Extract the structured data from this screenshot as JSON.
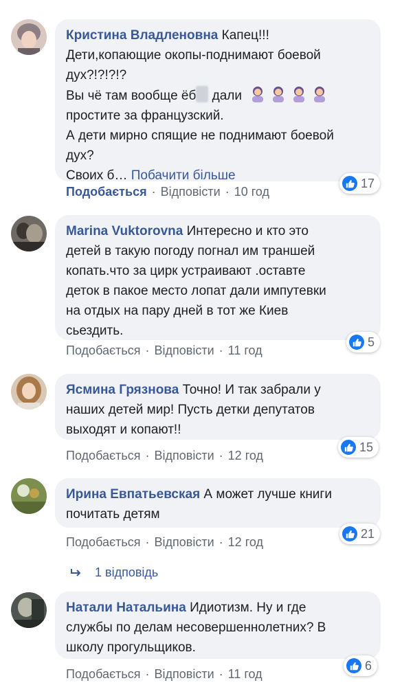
{
  "comments": [
    {
      "author": "Кристина Владленовна",
      "text_l1": " Капец!!!",
      "text_l2": "Дети,копающие окопы-поднимают боевой",
      "text_l3": "дух?!?!?!?",
      "text_l4a": "Вы чё там вообще ёб",
      "text_l4b": " дали",
      "text_l5": "простите за французский.",
      "text_l6": "А дети мирно спящие не поднимают боевой",
      "text_l7": "дух?",
      "text_l8": "Своих б… ",
      "see_more": "Побачити більше",
      "like": "Подобається",
      "reply": "Відповісти",
      "time": "10 год",
      "reactions": "17"
    },
    {
      "author": "Marina Vuktorovna",
      "text_l1": " Интересно и кто это",
      "text_l2": "детей в такую погоду погнал им траншей",
      "text_l3": "копать.что за цирк устраивают .оставте",
      "text_l4": "деток в пакое место лопат дали импутевки",
      "text_l5": "на отдых на пару дней в тот же Киев",
      "text_l6": "сьездить.",
      "like": "Подобається",
      "reply": "Відповісти",
      "time": "11 год",
      "reactions": "5"
    },
    {
      "author": "Ясмина Грязнова",
      "text_l1": " Точно! И так забрали у",
      "text_l2": "наших детей мир! Пусть детки депутатов",
      "text_l3": "выходят и копают!!",
      "like": "Подобається",
      "reply": "Відповісти",
      "time": "12 год",
      "reactions": "15"
    },
    {
      "author": "Ирина Евпатьевская",
      "text_l1": " А может лучше книги",
      "text_l2": "почитать детям",
      "like": "Подобається",
      "reply": "Відповісти",
      "time": "12 год",
      "reactions": "21"
    },
    {
      "author": "Натали Натальина",
      "text_l1": " Идиотизм. Ну и где",
      "text_l2": "службы по делам несовершеннолетних? В",
      "text_l3": "школу прогульщиков.",
      "like": "Подобається",
      "reply": "Відповісти",
      "time": "11 год",
      "reactions": "6"
    }
  ],
  "replies_link": "1 відповідь",
  "colors": {
    "author": "#385898",
    "bubble": "#f0f2f5",
    "like_badge": "#1877f2",
    "meta": "#606770"
  },
  "icons": [
    "like-icon",
    "reply-arrow-icon",
    "woman-gesturing-emoji"
  ]
}
